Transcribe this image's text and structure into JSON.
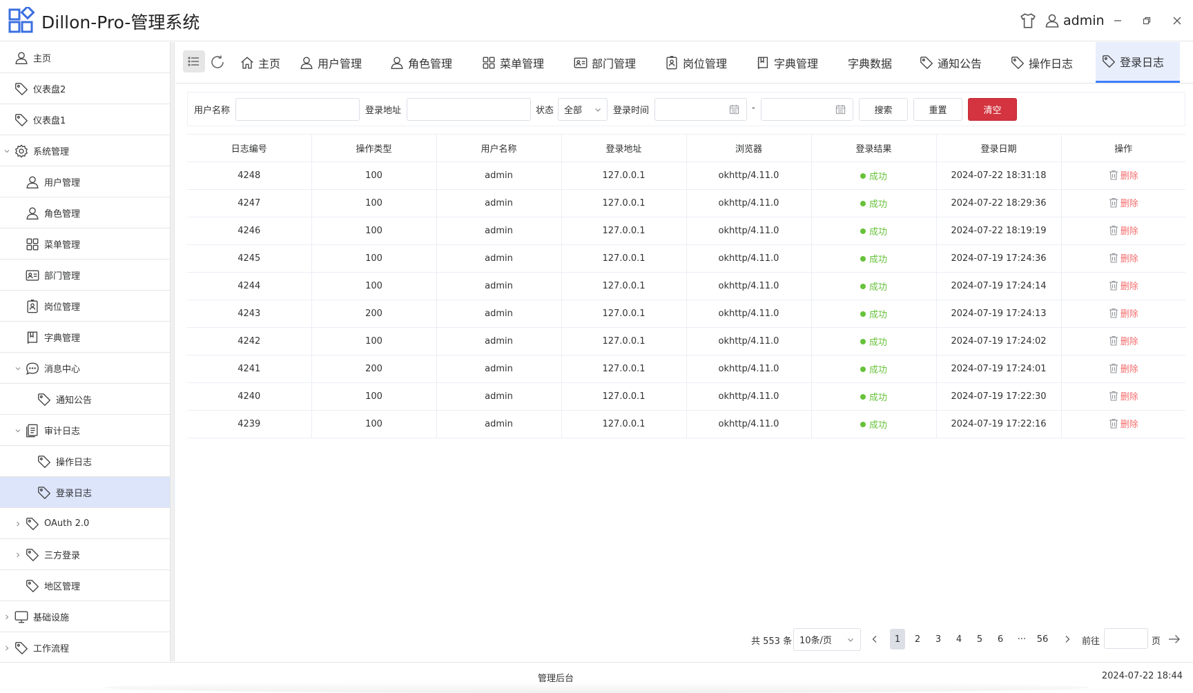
{
  "app": {
    "title": "Dillon-Pro-管理系统",
    "user": "admin",
    "accent": "#3d7eff"
  },
  "sidebar": {
    "items": [
      {
        "label": "主页",
        "icon": "user-icon"
      },
      {
        "label": "仪表盘2",
        "icon": "tag-icon"
      },
      {
        "label": "仪表盘1",
        "icon": "tag-icon"
      },
      {
        "label": "系统管理",
        "icon": "gear-icon"
      },
      {
        "label": "用户管理",
        "icon": "user-icon"
      },
      {
        "label": "角色管理",
        "icon": "user-icon"
      },
      {
        "label": "菜单管理",
        "icon": "grid-icon"
      },
      {
        "label": "部门管理",
        "icon": "id-card-icon"
      },
      {
        "label": "岗位管理",
        "icon": "badge-icon"
      },
      {
        "label": "字典管理",
        "icon": "book-icon"
      },
      {
        "label": "消息中心",
        "icon": "chat-icon"
      },
      {
        "label": "通知公告",
        "icon": "tag-icon"
      },
      {
        "label": "审计日志",
        "icon": "document-icon"
      },
      {
        "label": "操作日志",
        "icon": "tag-icon"
      },
      {
        "label": "登录日志",
        "icon": "tag-icon"
      },
      {
        "label": "OAuth 2.0",
        "icon": "tag-icon"
      },
      {
        "label": "三方登录",
        "icon": "tag-icon"
      },
      {
        "label": "地区管理",
        "icon": "tag-icon"
      },
      {
        "label": "基础设施",
        "icon": "monitor-icon"
      },
      {
        "label": "工作流程",
        "icon": "tag-icon"
      }
    ]
  },
  "tabs": [
    {
      "label": "主页",
      "icon": "home-icon"
    },
    {
      "label": "用户管理",
      "icon": "user-icon"
    },
    {
      "label": "角色管理",
      "icon": "user-icon"
    },
    {
      "label": "菜单管理",
      "icon": "grid-icon"
    },
    {
      "label": "部门管理",
      "icon": "id-card-icon"
    },
    {
      "label": "岗位管理",
      "icon": "badge-icon"
    },
    {
      "label": "字典管理",
      "icon": "book-icon"
    },
    {
      "label": "字典数据",
      "icon": ""
    },
    {
      "label": "通知公告",
      "icon": "tag-icon"
    },
    {
      "label": "操作日志",
      "icon": "tag-icon"
    },
    {
      "label": "登录日志",
      "icon": "tag-icon"
    }
  ],
  "search": {
    "username_label": "用户名称",
    "username_value": "",
    "address_label": "登录地址",
    "address_value": "",
    "status_label": "状态",
    "status_value": "全部",
    "time_label": "登录时间",
    "time_separator": "-",
    "search_button": "搜索",
    "reset_button": "重置",
    "clear_button": "清空"
  },
  "table": {
    "columns": [
      "日志编号",
      "操作类型",
      "用户名称",
      "登录地址",
      "浏览器",
      "登录结果",
      "登录日期",
      "操作"
    ],
    "rows": [
      {
        "id": "4248",
        "type": "100",
        "user": "admin",
        "ip": "127.0.0.1",
        "browser": "okhttp/4.11.0",
        "result": "成功",
        "date": "2024-07-22 18:31:18",
        "action": "删除"
      },
      {
        "id": "4247",
        "type": "100",
        "user": "admin",
        "ip": "127.0.0.1",
        "browser": "okhttp/4.11.0",
        "result": "成功",
        "date": "2024-07-22 18:29:36",
        "action": "删除"
      },
      {
        "id": "4246",
        "type": "100",
        "user": "admin",
        "ip": "127.0.0.1",
        "browser": "okhttp/4.11.0",
        "result": "成功",
        "date": "2024-07-22 18:19:19",
        "action": "删除"
      },
      {
        "id": "4245",
        "type": "100",
        "user": "admin",
        "ip": "127.0.0.1",
        "browser": "okhttp/4.11.0",
        "result": "成功",
        "date": "2024-07-19 17:24:36",
        "action": "删除"
      },
      {
        "id": "4244",
        "type": "100",
        "user": "admin",
        "ip": "127.0.0.1",
        "browser": "okhttp/4.11.0",
        "result": "成功",
        "date": "2024-07-19 17:24:14",
        "action": "删除"
      },
      {
        "id": "4243",
        "type": "200",
        "user": "admin",
        "ip": "127.0.0.1",
        "browser": "okhttp/4.11.0",
        "result": "成功",
        "date": "2024-07-19 17:24:13",
        "action": "删除"
      },
      {
        "id": "4242",
        "type": "100",
        "user": "admin",
        "ip": "127.0.0.1",
        "browser": "okhttp/4.11.0",
        "result": "成功",
        "date": "2024-07-19 17:24:02",
        "action": "删除"
      },
      {
        "id": "4241",
        "type": "200",
        "user": "admin",
        "ip": "127.0.0.1",
        "browser": "okhttp/4.11.0",
        "result": "成功",
        "date": "2024-07-19 17:24:01",
        "action": "删除"
      },
      {
        "id": "4240",
        "type": "100",
        "user": "admin",
        "ip": "127.0.0.1",
        "browser": "okhttp/4.11.0",
        "result": "成功",
        "date": "2024-07-19 17:22:30",
        "action": "删除"
      },
      {
        "id": "4239",
        "type": "100",
        "user": "admin",
        "ip": "127.0.0.1",
        "browser": "okhttp/4.11.0",
        "result": "成功",
        "date": "2024-07-19 17:22:16",
        "action": "删除"
      }
    ]
  },
  "pagination": {
    "total": "共 553 条",
    "page_size": "10条/页",
    "pages": [
      "1",
      "2",
      "3",
      "4",
      "5",
      "6",
      "···",
      "56"
    ],
    "current": "1",
    "goto_label": "前往",
    "goto_value": "",
    "page_suffix": "页"
  },
  "footer": {
    "title": "管理后台",
    "datetime": "2024-07-22 18:44"
  }
}
